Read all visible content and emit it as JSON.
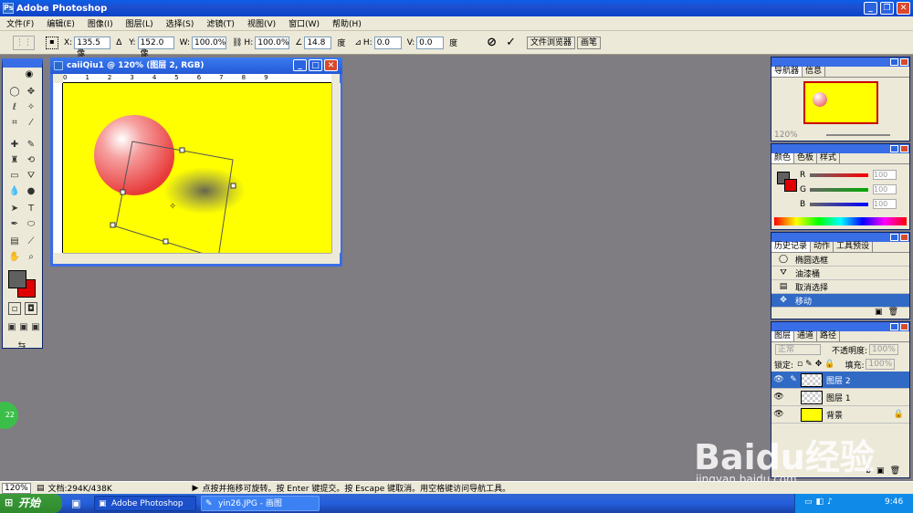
{
  "app": {
    "title": "Adobe Photoshop"
  },
  "menu": [
    "文件(F)",
    "编辑(E)",
    "图像(I)",
    "图层(L)",
    "选择(S)",
    "滤镜(T)",
    "视图(V)",
    "窗口(W)",
    "帮助(H)"
  ],
  "options": {
    "x_label": "X:",
    "x_value": "135.5 像",
    "y_label": "Y:",
    "y_value": "152.0 像",
    "w_label": "W:",
    "w_value": "100.0%",
    "h_label": "H:",
    "h_value": "100.0%",
    "angle_value": "14.8",
    "angle_unit": "度",
    "skew_h_label": "H:",
    "skew_h_value": "0.0",
    "skew_v_label": "V:",
    "skew_v_value": "0.0",
    "skew_unit": "度",
    "tab_browser": "文件浏览器",
    "tab_brush": "画笔"
  },
  "document": {
    "title": "caiiQiu1 @ 120% (图层 2, RGB)"
  },
  "navigator": {
    "tabs": [
      "导航器",
      "信息"
    ],
    "zoom": "120%"
  },
  "color": {
    "tabs": [
      "颜色",
      "色板",
      "样式"
    ],
    "r_label": "R",
    "g_label": "G",
    "b_label": "B",
    "r_value": "100",
    "g_value": "100",
    "b_value": "100"
  },
  "history": {
    "tabs": [
      "历史记录",
      "动作",
      "工具预设"
    ],
    "items": [
      "椭圆选框",
      "油漆桶",
      "取消选择",
      "移动"
    ]
  },
  "layers": {
    "tabs": [
      "图层",
      "通道",
      "路径"
    ],
    "mode": "正常",
    "opacity_label": "不透明度:",
    "opacity_value": "100%",
    "lock_label": "锁定:",
    "fill_label": "填充:",
    "fill_value": "100%",
    "items": [
      "图层 2",
      "图层 1",
      "背景"
    ]
  },
  "status": {
    "zoom": "120%",
    "doc_info": "文档:294K/438K",
    "hint": "点按并拖移可旋转。按 Enter 键提交。按 Escape 键取消。用空格键访问导航工具。"
  },
  "taskbar": {
    "start": "开始",
    "task1": "Adobe Photoshop",
    "task2": "yin26.JPG - 画图",
    "time": "9:46"
  },
  "badge": "22",
  "watermark": {
    "main": "Baidu经验",
    "url": "jingyan.baidu.com"
  },
  "colors": {
    "canvas": "#ffff00",
    "foreground": "#606060",
    "background": "#e00000",
    "selection": "#316ac5"
  }
}
